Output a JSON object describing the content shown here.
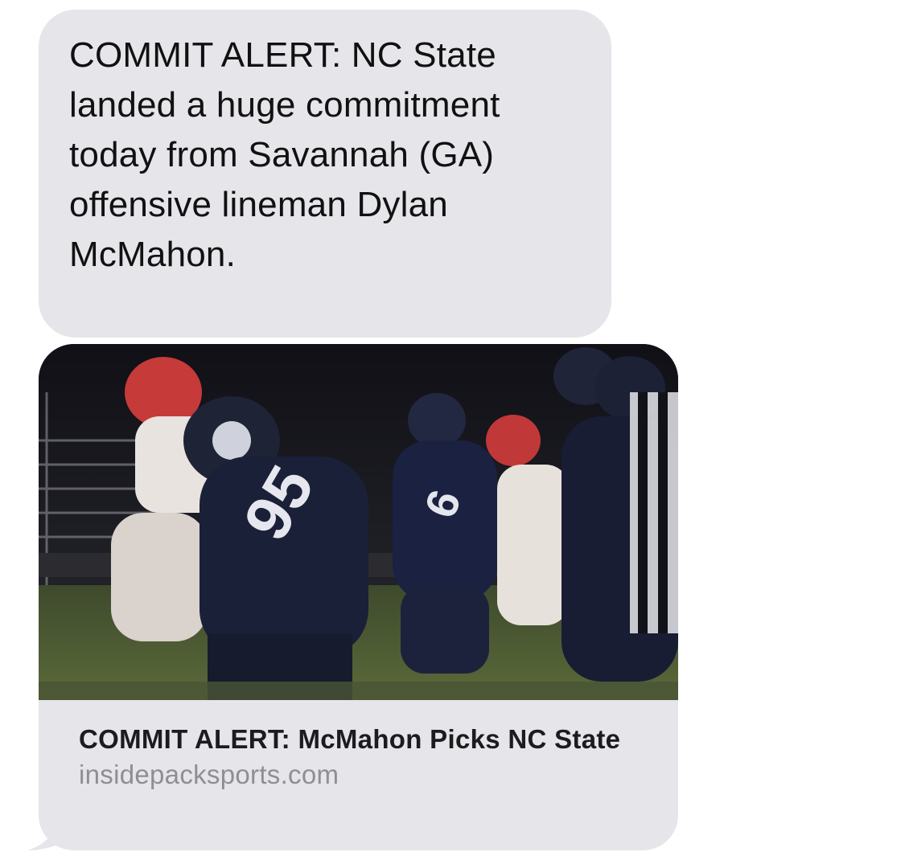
{
  "messages": [
    {
      "text": "COMMIT ALERT: NC State landed a huge commitment today from Savannah (GA) offensive lineman Dylan McMahon."
    }
  ],
  "link_preview": {
    "title": "COMMIT ALERT: McMahon Picks NC State",
    "domain": "insidepacksports.com",
    "image": "football-photo"
  },
  "colors": {
    "bubble": "#e5e5ea",
    "text": "#111111",
    "domain": "#8e8e93"
  }
}
